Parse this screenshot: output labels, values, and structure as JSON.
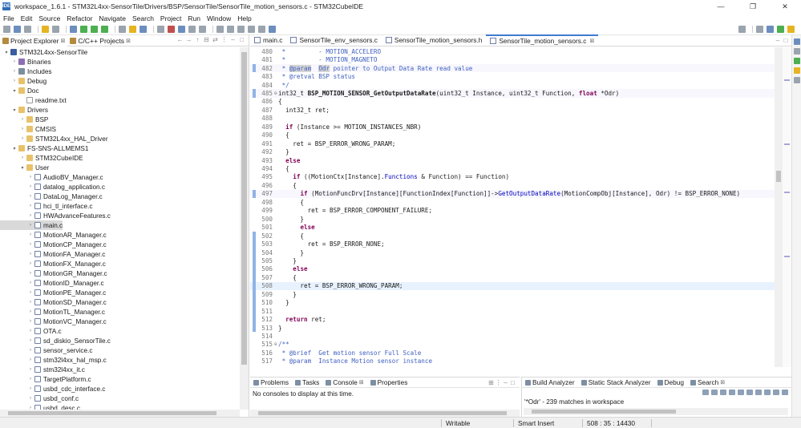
{
  "window": {
    "title": "workspace_1.6.1 - STM32L4xx-SensorTile/Drivers/BSP/SensorTile/SensorTile_motion_sensors.c - STM32CubeIDE",
    "app_icon": "IDE",
    "controls": [
      "—",
      "❐",
      "✕"
    ]
  },
  "menu": [
    "File",
    "Edit",
    "Source",
    "Refactor",
    "Navigate",
    "Search",
    "Project",
    "Run",
    "Window",
    "Help"
  ],
  "left_panel": {
    "tabs": [
      {
        "label": "Project Explorer",
        "close": "⊠"
      },
      {
        "label": "C/C++ Projects",
        "close": "⊠"
      }
    ],
    "tree": [
      {
        "depth": 0,
        "twisty": "▾",
        "icon": "proj",
        "label": "STM32L4xx-SensorTile"
      },
      {
        "depth": 1,
        "twisty": "›",
        "icon": "bin",
        "label": "Binaries"
      },
      {
        "depth": 1,
        "twisty": "›",
        "icon": "inc",
        "label": "Includes"
      },
      {
        "depth": 1,
        "twisty": "›",
        "icon": "folder",
        "label": "Debug"
      },
      {
        "depth": 1,
        "twisty": "▾",
        "icon": "folder",
        "label": "Doc"
      },
      {
        "depth": 2,
        "twisty": "",
        "icon": "txt",
        "label": "readme.txt"
      },
      {
        "depth": 1,
        "twisty": "▾",
        "icon": "folder",
        "label": "Drivers"
      },
      {
        "depth": 2,
        "twisty": "›",
        "icon": "folder",
        "label": "BSP"
      },
      {
        "depth": 2,
        "twisty": "›",
        "icon": "folder",
        "label": "CMSIS"
      },
      {
        "depth": 2,
        "twisty": "›",
        "icon": "folder",
        "label": "STM32L4xx_HAL_Driver"
      },
      {
        "depth": 1,
        "twisty": "▾",
        "icon": "folder",
        "label": "FS-SNS-ALLMEMS1"
      },
      {
        "depth": 2,
        "twisty": "›",
        "icon": "folder",
        "label": "STM32CubeIDE"
      },
      {
        "depth": 2,
        "twisty": "▾",
        "icon": "folder",
        "label": "User"
      },
      {
        "depth": 3,
        "twisty": "›",
        "icon": "cfile",
        "label": "AudioBV_Manager.c"
      },
      {
        "depth": 3,
        "twisty": "›",
        "icon": "cfile",
        "label": "datalog_application.c"
      },
      {
        "depth": 3,
        "twisty": "›",
        "icon": "cfile",
        "label": "DataLog_Manager.c"
      },
      {
        "depth": 3,
        "twisty": "›",
        "icon": "cfile",
        "label": "hci_tl_interface.c"
      },
      {
        "depth": 3,
        "twisty": "›",
        "icon": "cfile",
        "label": "HWAdvanceFeatures.c"
      },
      {
        "depth": 3,
        "twisty": "›",
        "icon": "cfile",
        "label": "main.c",
        "selected": true
      },
      {
        "depth": 3,
        "twisty": "›",
        "icon": "cfile",
        "label": "MotionAR_Manager.c"
      },
      {
        "depth": 3,
        "twisty": "›",
        "icon": "cfile",
        "label": "MotionCP_Manager.c"
      },
      {
        "depth": 3,
        "twisty": "›",
        "icon": "cfile",
        "label": "MotionFA_Manager.c"
      },
      {
        "depth": 3,
        "twisty": "›",
        "icon": "cfile",
        "label": "MotionFX_Manager.c"
      },
      {
        "depth": 3,
        "twisty": "›",
        "icon": "cfile",
        "label": "MotionGR_Manager.c"
      },
      {
        "depth": 3,
        "twisty": "›",
        "icon": "cfile",
        "label": "MotionID_Manager.c"
      },
      {
        "depth": 3,
        "twisty": "›",
        "icon": "cfile",
        "label": "MotionPE_Manager.c"
      },
      {
        "depth": 3,
        "twisty": "›",
        "icon": "cfile",
        "label": "MotionSD_Manager.c"
      },
      {
        "depth": 3,
        "twisty": "›",
        "icon": "cfile",
        "label": "MotionTL_Manager.c"
      },
      {
        "depth": 3,
        "twisty": "›",
        "icon": "cfile",
        "label": "MotionVC_Manager.c"
      },
      {
        "depth": 3,
        "twisty": "›",
        "icon": "cfile",
        "label": "OTA.c"
      },
      {
        "depth": 3,
        "twisty": "›",
        "icon": "cfile",
        "label": "sd_diskio_SensorTile.c"
      },
      {
        "depth": 3,
        "twisty": "›",
        "icon": "cfile",
        "label": "sensor_service.c"
      },
      {
        "depth": 3,
        "twisty": "›",
        "icon": "cfile",
        "label": "stm32l4xx_hal_msp.c"
      },
      {
        "depth": 3,
        "twisty": "›",
        "icon": "cfile",
        "label": "stm32l4xx_it.c"
      },
      {
        "depth": 3,
        "twisty": "›",
        "icon": "cfile",
        "label": "TargetPlatform.c"
      },
      {
        "depth": 3,
        "twisty": "›",
        "icon": "cfile",
        "label": "usbd_cdc_interface.c"
      },
      {
        "depth": 3,
        "twisty": "›",
        "icon": "cfile",
        "label": "usbd_conf.c"
      },
      {
        "depth": 3,
        "twisty": "›",
        "icon": "cfile",
        "label": "usbd_desc.c"
      }
    ]
  },
  "editor": {
    "tabs": [
      {
        "label": "main.c",
        "active": false
      },
      {
        "label": "SensorTile_env_sensors.c",
        "active": false
      },
      {
        "label": "SensorTile_motion_sensors.h",
        "active": false
      },
      {
        "label": "SensorTile_motion_sensors.c",
        "active": true
      }
    ],
    "close_glyph": "⊠",
    "lines": [
      {
        "n": "480",
        "fold": "",
        "segs": [
          {
            "t": " *         - MOTION_ACCELERO",
            "c": "c-doc"
          }
        ]
      },
      {
        "n": "481",
        "fold": "",
        "segs": [
          {
            "t": " *         - MOTION_MAGNETO",
            "c": "c-doc"
          }
        ]
      },
      {
        "n": "482",
        "fold": "",
        "occ": true,
        "segs": [
          {
            "t": " * ",
            "c": "c-doc"
          },
          {
            "t": "@param",
            "c": "c-doc c-mark"
          },
          {
            "t": "  ",
            "c": "c-doc"
          },
          {
            "t": "Odr",
            "c": "c-doc c-mark"
          },
          {
            "t": " pointer to Output Data Rate read value",
            "c": "c-doc"
          }
        ]
      },
      {
        "n": "483",
        "fold": "",
        "segs": [
          {
            "t": " * @retval BSP status",
            "c": "c-doc"
          }
        ]
      },
      {
        "n": "484",
        "fold": "",
        "segs": [
          {
            "t": " */",
            "c": "c-doc"
          }
        ]
      },
      {
        "n": "485",
        "fold": "⊖",
        "occ": true,
        "segs": [
          {
            "t": "int32_t ",
            "c": ""
          },
          {
            "t": "BSP_MOTION_SENSOR_GetOutputDataRate",
            "c": "c-fn"
          },
          {
            "t": "(uint32_t Instance, uint32_t Function, ",
            "c": ""
          },
          {
            "t": "float",
            "c": "c-key"
          },
          {
            "t": " *Odr)",
            "c": ""
          }
        ]
      },
      {
        "n": "486",
        "fold": "",
        "segs": [
          {
            "t": "{",
            "c": ""
          }
        ]
      },
      {
        "n": "487",
        "fold": "",
        "segs": [
          {
            "t": "  int32_t ret;",
            "c": ""
          }
        ]
      },
      {
        "n": "488",
        "fold": "",
        "segs": [
          {
            "t": "",
            "c": ""
          }
        ]
      },
      {
        "n": "489",
        "fold": "",
        "segs": [
          {
            "t": "  ",
            "c": ""
          },
          {
            "t": "if",
            "c": "c-key"
          },
          {
            "t": " (Instance >= MOTION_INSTANCES_NBR)",
            "c": ""
          }
        ]
      },
      {
        "n": "490",
        "fold": "",
        "segs": [
          {
            "t": "  {",
            "c": ""
          }
        ]
      },
      {
        "n": "491",
        "fold": "",
        "segs": [
          {
            "t": "    ret = BSP_ERROR_WRONG_PARAM;",
            "c": ""
          }
        ]
      },
      {
        "n": "492",
        "fold": "",
        "segs": [
          {
            "t": "  }",
            "c": ""
          }
        ]
      },
      {
        "n": "493",
        "fold": "",
        "segs": [
          {
            "t": "  ",
            "c": ""
          },
          {
            "t": "else",
            "c": "c-key"
          }
        ]
      },
      {
        "n": "494",
        "fold": "",
        "segs": [
          {
            "t": "  {",
            "c": ""
          }
        ]
      },
      {
        "n": "495",
        "fold": "",
        "segs": [
          {
            "t": "    ",
            "c": ""
          },
          {
            "t": "if",
            "c": "c-key"
          },
          {
            "t": " ((MotionCtx[Instance].",
            "c": ""
          },
          {
            "t": "Functions",
            "c": "c-fld"
          },
          {
            "t": " & Function) == Function)",
            "c": ""
          }
        ]
      },
      {
        "n": "496",
        "fold": "",
        "segs": [
          {
            "t": "    {",
            "c": ""
          }
        ]
      },
      {
        "n": "497",
        "fold": "",
        "occ": true,
        "segs": [
          {
            "t": "      ",
            "c": ""
          },
          {
            "t": "if",
            "c": "c-key"
          },
          {
            "t": " (MotionFuncDrv[Instance][FunctionIndex[Function]]->",
            "c": ""
          },
          {
            "t": "GetOutputDataRate",
            "c": "c-fld"
          },
          {
            "t": "(MotionCompObj[Instance], Odr) != BSP_ERROR_NONE)",
            "c": ""
          }
        ]
      },
      {
        "n": "498",
        "fold": "",
        "segs": [
          {
            "t": "      {",
            "c": ""
          }
        ]
      },
      {
        "n": "499",
        "fold": "",
        "segs": [
          {
            "t": "        ret = BSP_ERROR_COMPONENT_FAILURE;",
            "c": ""
          }
        ]
      },
      {
        "n": "500",
        "fold": "",
        "segs": [
          {
            "t": "      }",
            "c": ""
          }
        ]
      },
      {
        "n": "501",
        "fold": "",
        "segs": [
          {
            "t": "      ",
            "c": ""
          },
          {
            "t": "else",
            "c": "c-key"
          }
        ]
      },
      {
        "n": "502",
        "fold": "",
        "segs": [
          {
            "t": "      {",
            "c": ""
          }
        ]
      },
      {
        "n": "503",
        "fold": "",
        "segs": [
          {
            "t": "        ret = BSP_ERROR_NONE;",
            "c": ""
          }
        ]
      },
      {
        "n": "504",
        "fold": "",
        "segs": [
          {
            "t": "      }",
            "c": ""
          }
        ]
      },
      {
        "n": "505",
        "fold": "",
        "segs": [
          {
            "t": "    }",
            "c": ""
          }
        ]
      },
      {
        "n": "506",
        "fold": "",
        "segs": [
          {
            "t": "    ",
            "c": ""
          },
          {
            "t": "else",
            "c": "c-key"
          }
        ]
      },
      {
        "n": "507",
        "fold": "",
        "segs": [
          {
            "t": "    {",
            "c": ""
          }
        ]
      },
      {
        "n": "508",
        "fold": "",
        "hl": true,
        "segs": [
          {
            "t": "      ret = BSP_ERROR_WRONG_PARAM;",
            "c": ""
          }
        ]
      },
      {
        "n": "509",
        "fold": "",
        "segs": [
          {
            "t": "    }",
            "c": ""
          }
        ]
      },
      {
        "n": "510",
        "fold": "",
        "segs": [
          {
            "t": "  }",
            "c": ""
          }
        ]
      },
      {
        "n": "511",
        "fold": "",
        "segs": [
          {
            "t": "",
            "c": ""
          }
        ]
      },
      {
        "n": "512",
        "fold": "",
        "segs": [
          {
            "t": "  ",
            "c": ""
          },
          {
            "t": "return",
            "c": "c-key"
          },
          {
            "t": " ret;",
            "c": ""
          }
        ]
      },
      {
        "n": "513",
        "fold": "",
        "segs": [
          {
            "t": "}",
            "c": ""
          }
        ]
      },
      {
        "n": "514",
        "fold": "",
        "segs": [
          {
            "t": "",
            "c": ""
          }
        ]
      },
      {
        "n": "515",
        "fold": "⊖",
        "segs": [
          {
            "t": "/**",
            "c": "c-doc"
          }
        ]
      },
      {
        "n": "516",
        "fold": "",
        "segs": [
          {
            "t": " * @brief  Get motion sensor Full Scale",
            "c": "c-doc"
          }
        ]
      },
      {
        "n": "517",
        "fold": "",
        "segs": [
          {
            "t": " * @param  Instance Motion sensor instance",
            "c": "c-doc"
          }
        ]
      }
    ]
  },
  "console_panel": {
    "tabs": [
      {
        "label": "Problems",
        "active": false
      },
      {
        "label": "Tasks",
        "active": false
      },
      {
        "label": "Console",
        "active": true
      },
      {
        "label": "Properties",
        "active": false
      }
    ],
    "message": "No consoles to display at this time."
  },
  "search_panel": {
    "tabs": [
      {
        "label": "Build Analyzer",
        "active": false
      },
      {
        "label": "Static Stack Analyzer",
        "active": false
      },
      {
        "label": "Debug",
        "active": false
      },
      {
        "label": "Search",
        "active": true
      }
    ],
    "result": "'*Odr' - 239 matches in workspace"
  },
  "status": {
    "writable": "Writable",
    "insert_mode": "Smart Insert",
    "position": "508 : 35 : 14430"
  }
}
